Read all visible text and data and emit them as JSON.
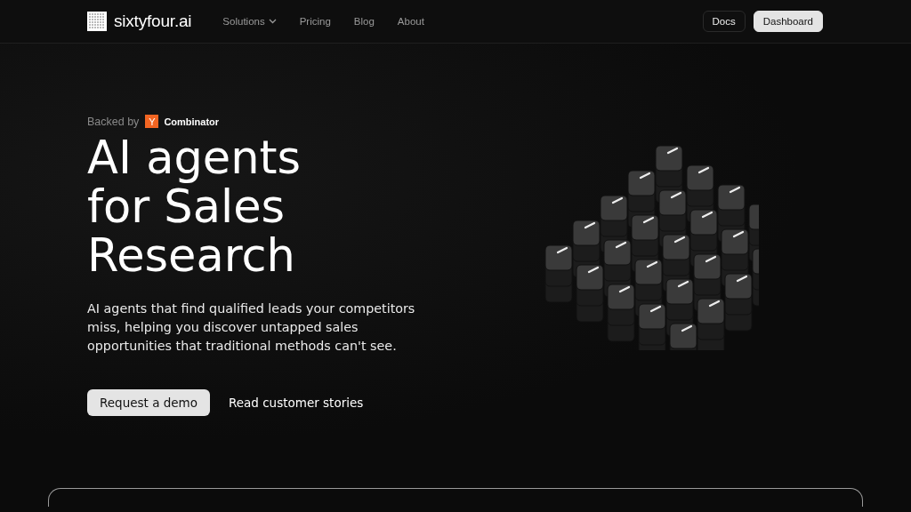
{
  "header": {
    "logo_text": "sixtyfour.ai",
    "nav": [
      {
        "label": "Solutions",
        "dropdown": true
      },
      {
        "label": "Pricing",
        "dropdown": false
      },
      {
        "label": "Blog",
        "dropdown": false
      },
      {
        "label": "About",
        "dropdown": false
      }
    ],
    "actions": [
      {
        "label": "Docs",
        "kind": "outline"
      },
      {
        "label": "Dashboard",
        "kind": "filled"
      }
    ]
  },
  "hero": {
    "backed_by": "Backed by",
    "badge_letter": "Y",
    "badge_name": "Combinator",
    "headline": "AI agents for Sales Research",
    "description": "AI agents that find qualified leads your competitors miss, helping you discover untapped sales opportunities that traditional methods can't see.",
    "buttons": [
      {
        "label": "Request a demo",
        "kind": "filled"
      },
      {
        "label": "Read customer stories",
        "kind": "plain"
      }
    ]
  }
}
